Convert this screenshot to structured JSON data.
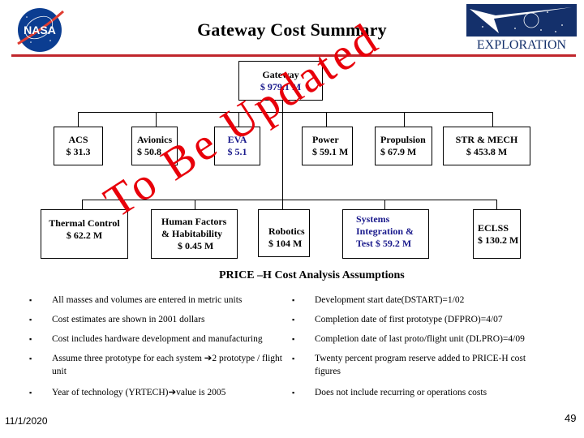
{
  "header": {
    "title": "Gateway Cost Summary",
    "left_logo": "nasa-logo",
    "right_logo": "exploration-logo",
    "right_logo_text": "EXPLORATION",
    "left_logo_text": "NASA"
  },
  "colors": {
    "rule": "#c0262c",
    "watermark": "#e8000a",
    "highlight_text": "#1a1a8c"
  },
  "org_chart": {
    "root": {
      "name": "Gateway",
      "cost": "$ 979.1 M"
    },
    "row1": [
      {
        "name": "ACS",
        "cost": "$ 31.3"
      },
      {
        "name": "Avionics",
        "cost": "$ 50.8"
      },
      {
        "name": "EVA",
        "cost": "$ 5.1"
      },
      {
        "name": "Power",
        "cost": "$ 59.1 M"
      },
      {
        "name": "Propulsion",
        "cost": "$ 67.9 M"
      },
      {
        "name": "STR & MECH",
        "cost": "$ 453.8 M"
      }
    ],
    "row2": [
      {
        "name": "Thermal Control",
        "cost": "$ 62.2 M"
      },
      {
        "name": "Human Factors",
        "name2": "& Habitability",
        "cost": "$ 0.45 M"
      },
      {
        "name": "Robotics",
        "cost": "$ 104 M"
      },
      {
        "name": "Systems",
        "name2": "Integration &",
        "cost": "Test $ 59.2 M"
      },
      {
        "name": "ECLSS",
        "cost": "$ 130.2 M"
      }
    ]
  },
  "watermark": "To Be Updated",
  "assumptions": {
    "title": "PRICE –H Cost Analysis Assumptions",
    "bullet_glyph": "▪",
    "left": [
      "All masses and volumes are entered in metric units",
      "Cost estimates are shown in 2001 dollars",
      "Cost includes hardware development and manufacturing",
      "Assume three prototype for each system  ➔2 prototype / flight unit",
      "Year of technology (YRTECH)➔value is 2005"
    ],
    "right": [
      "Development start date(DSTART)=1/02",
      "Completion date of first prototype (DFPRO)=4/07",
      "Completion date of last proto/flight unit (DLPRO)=4/09",
      "Twenty percent program reserve added to PRICE-H cost figures",
      "Does not include recurring or operations costs"
    ]
  },
  "footer": {
    "date": "11/1/2020",
    "page_number": "49"
  }
}
